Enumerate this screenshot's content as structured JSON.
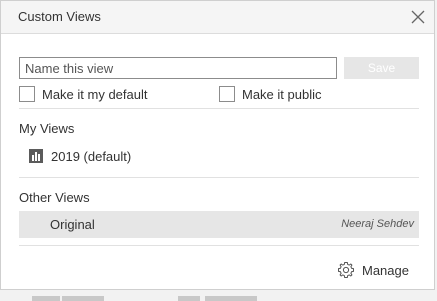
{
  "dialog": {
    "title": "Custom Views",
    "close_icon": "close-icon"
  },
  "form": {
    "name_placeholder": "Name this view",
    "save_label": "Save",
    "default_checkbox_label": "Make it my default",
    "public_checkbox_label": "Make it public"
  },
  "my_views": {
    "heading": "My Views",
    "items": [
      {
        "label": "2019 (default)",
        "icon": "view-thumbnail-icon"
      }
    ]
  },
  "other_views": {
    "heading": "Other Views",
    "items": [
      {
        "label": "Original",
        "owner": "Neeraj Sehdev"
      }
    ]
  },
  "footer": {
    "manage_label": "Manage",
    "manage_icon": "gear-icon"
  },
  "colors": {
    "selected_row": "#e6e6e6",
    "save_disabled": "#e6e6e6",
    "divider": "#e1e1e1"
  }
}
